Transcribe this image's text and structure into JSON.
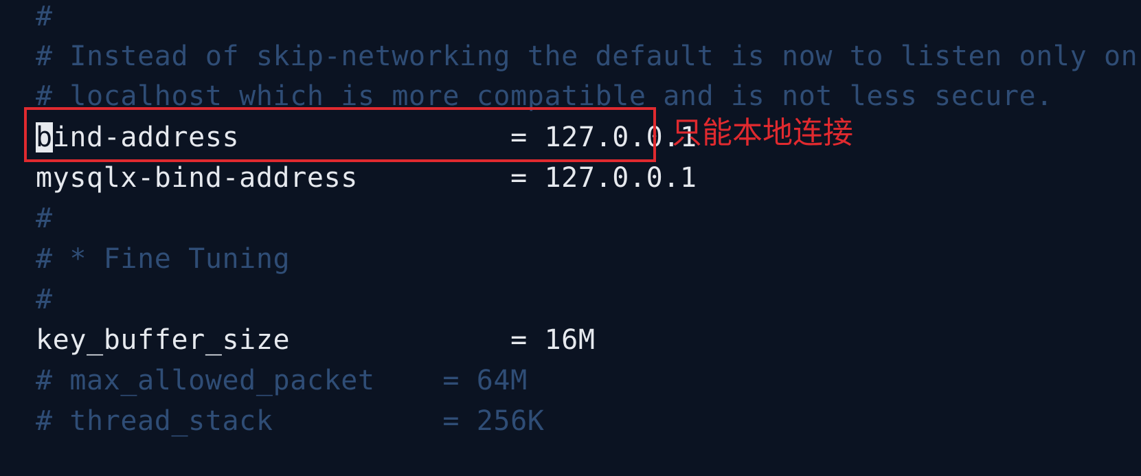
{
  "lines": [
    {
      "kind": "comment",
      "text": "#"
    },
    {
      "kind": "comment",
      "text": "# Instead of skip-networking the default is now to listen only on"
    },
    {
      "kind": "comment",
      "text": "# localhost which is more compatible and is not less secure."
    },
    {
      "kind": "code",
      "key_first_char": "b",
      "key_rest": "ind-address",
      "pad": "                ",
      "value": "= 127.0.0.1"
    },
    {
      "kind": "code",
      "key": "mysqlx-bind-address",
      "pad": "         ",
      "value": "= 127.0.0.1"
    },
    {
      "kind": "comment",
      "text": "#"
    },
    {
      "kind": "comment",
      "text": "# * Fine Tuning"
    },
    {
      "kind": "comment",
      "text": "#"
    },
    {
      "kind": "code",
      "key": "key_buffer_size",
      "pad": "             ",
      "value": "= 16M"
    },
    {
      "kind": "comment",
      "text": "# max_allowed_packet    = 64M"
    },
    {
      "kind": "comment",
      "text": "# thread_stack          = 256K"
    }
  ],
  "annotation": {
    "text": "只能本地连接",
    "color": "#e02a2f"
  },
  "colors": {
    "background": "#0b1322",
    "comment": "#2f4d76",
    "code": "#e6e9ee",
    "highlight": "#e02a2f"
  }
}
